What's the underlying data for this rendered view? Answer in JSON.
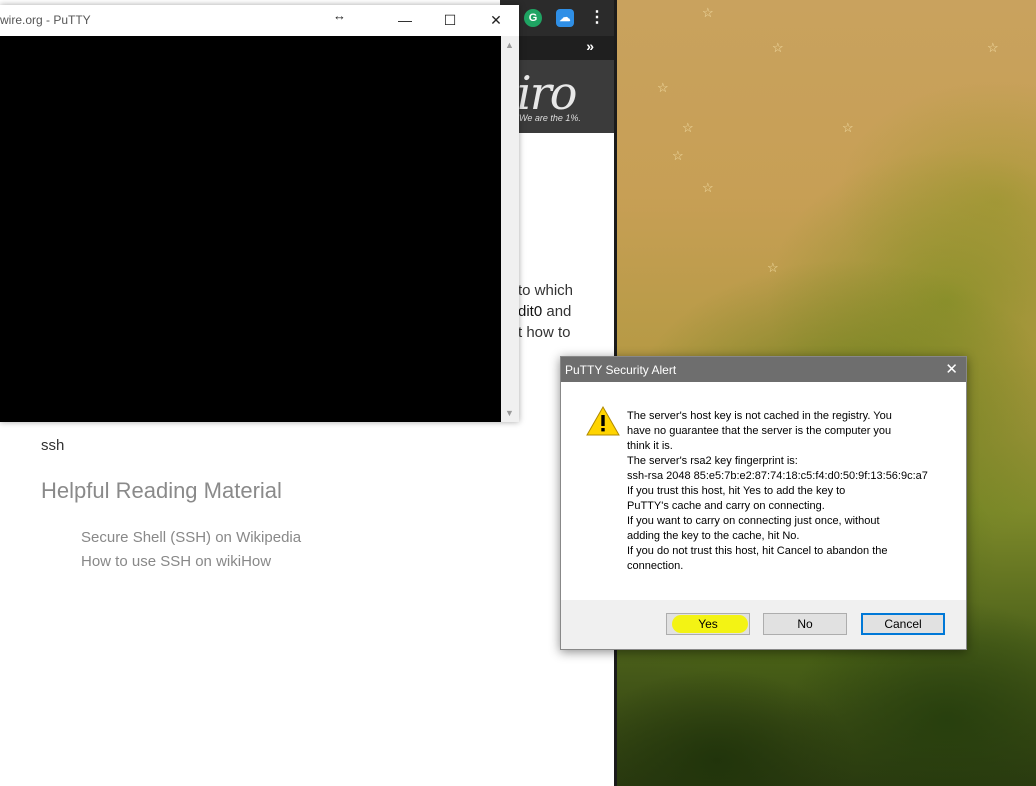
{
  "putty": {
    "title": "wire.org - PuTTY",
    "drag_glyph": "↔",
    "minimize": "—",
    "maximize": "☐",
    "close": "✕"
  },
  "browser": {
    "grammarly_glyph": "G",
    "bookmarks_more": "»",
    "menu_glyph": "⋮",
    "logo_text": "iro",
    "tagline": "We are the 1%.",
    "partial_lines": [
      "to which",
      "dit0",
      "and",
      "t how to"
    ],
    "ssh_word": "ssh",
    "helpful_heading": "Helpful Reading Material",
    "links": [
      "Secure Shell (SSH) on Wikipedia",
      "How to use SSH on wikiHow"
    ]
  },
  "alert": {
    "title": "PuTTY Security Alert",
    "close": "✕",
    "message_lines": [
      "The server's host key is not cached in the registry. You",
      "have no guarantee that the server is the computer you",
      "think it is.",
      "The server's rsa2 key fingerprint is:",
      "ssh-rsa 2048 85:e5:7b:e2:87:74:18:c5:f4:d0:50:9f:13:56:9c:a7",
      "If you trust this host, hit Yes to add the key to",
      "PuTTY's cache and carry on connecting.",
      "If you want to carry on connecting just once, without",
      "adding the key to the cache, hit No.",
      "If you do not trust this host, hit Cancel to abandon the",
      "connection."
    ],
    "buttons": {
      "yes": "Yes",
      "no": "No",
      "cancel": "Cancel"
    },
    "icon": "warning-icon",
    "highlight_color": "#f3f314"
  }
}
